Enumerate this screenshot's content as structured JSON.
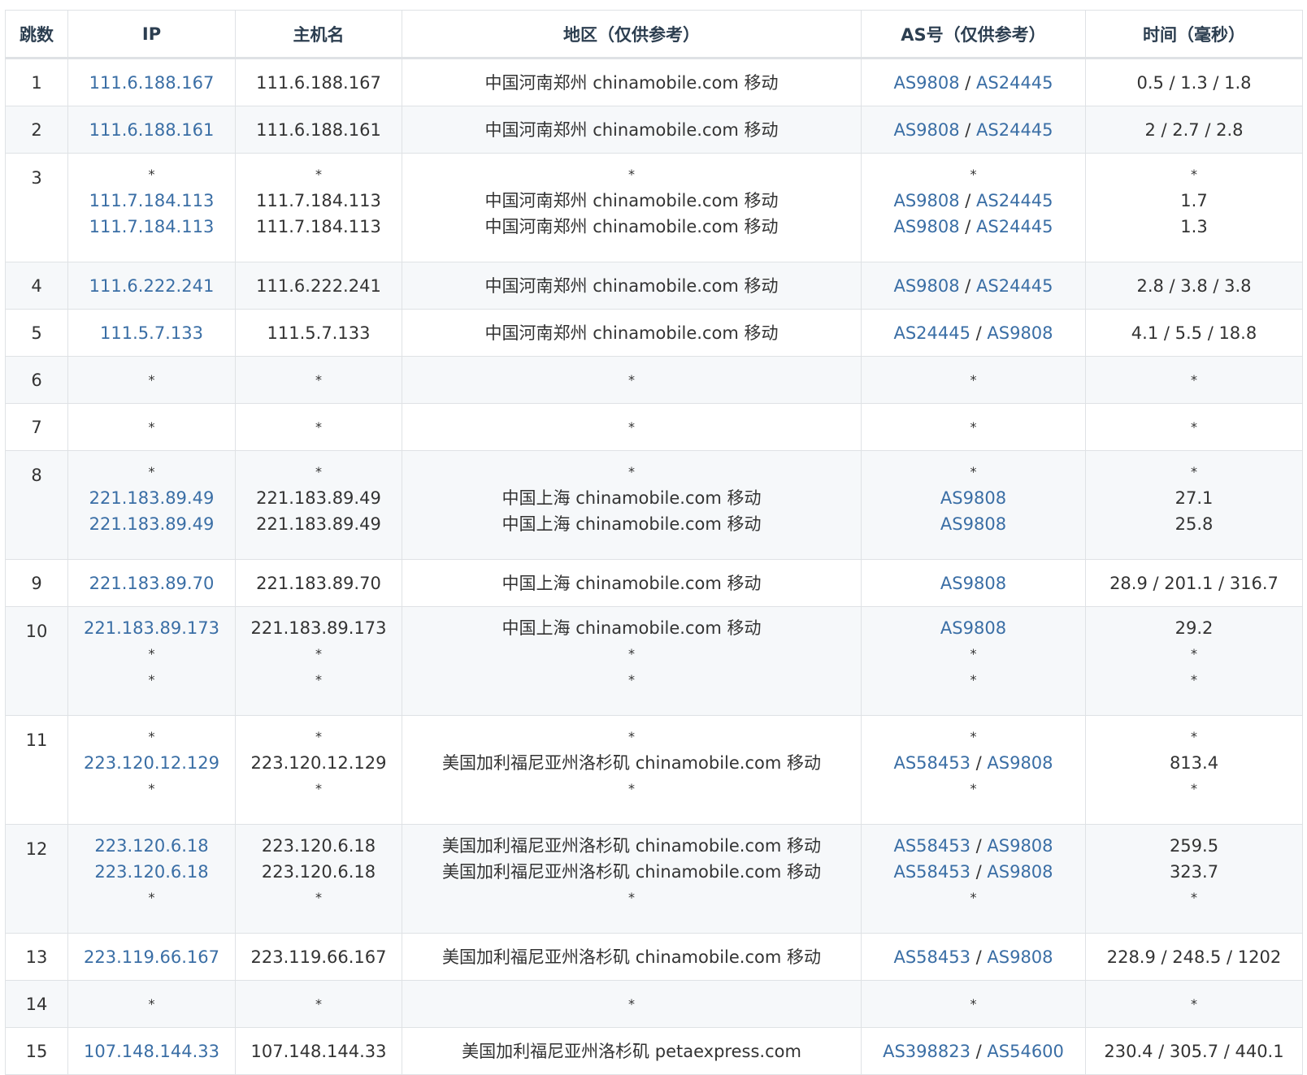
{
  "headers": [
    "跳数",
    "IP",
    "主机名",
    "地区（仅供参考）",
    "AS号（仅供参考）",
    "时间（毫秒）"
  ],
  "rows": [
    {
      "hop": "1",
      "ip": [
        "111.6.188.167"
      ],
      "host": [
        "111.6.188.167"
      ],
      "region": [
        "中国河南郑州 chinamobile.com 移动"
      ],
      "as": [
        [
          "AS9808",
          "AS24445"
        ]
      ],
      "time": [
        "0.5 / 1.3 / 1.8"
      ]
    },
    {
      "hop": "2",
      "ip": [
        "111.6.188.161"
      ],
      "host": [
        "111.6.188.161"
      ],
      "region": [
        "中国河南郑州 chinamobile.com 移动"
      ],
      "as": [
        [
          "AS9808",
          "AS24445"
        ]
      ],
      "time": [
        "2 / 2.7 / 2.8"
      ]
    },
    {
      "hop": "3",
      "ip": [
        "*",
        "111.7.184.113",
        "111.7.184.113"
      ],
      "host": [
        "*",
        "111.7.184.113",
        "111.7.184.113"
      ],
      "region": [
        "*",
        "中国河南郑州 chinamobile.com 移动",
        "中国河南郑州 chinamobile.com 移动"
      ],
      "as": [
        [
          "*"
        ],
        [
          "AS9808",
          "AS24445"
        ],
        [
          "AS9808",
          "AS24445"
        ]
      ],
      "time": [
        "*",
        "1.7",
        "1.3"
      ]
    },
    {
      "hop": "4",
      "ip": [
        "111.6.222.241"
      ],
      "host": [
        "111.6.222.241"
      ],
      "region": [
        "中国河南郑州 chinamobile.com 移动"
      ],
      "as": [
        [
          "AS9808",
          "AS24445"
        ]
      ],
      "time": [
        "2.8 / 3.8 / 3.8"
      ]
    },
    {
      "hop": "5",
      "ip": [
        "111.5.7.133"
      ],
      "host": [
        "111.5.7.133"
      ],
      "region": [
        "中国河南郑州 chinamobile.com 移动"
      ],
      "as": [
        [
          "AS24445",
          "AS9808"
        ]
      ],
      "time": [
        "4.1 / 5.5 / 18.8"
      ]
    },
    {
      "hop": "6",
      "ip": [
        "*"
      ],
      "host": [
        "*"
      ],
      "region": [
        "*"
      ],
      "as": [
        [
          "*"
        ]
      ],
      "time": [
        "*"
      ]
    },
    {
      "hop": "7",
      "ip": [
        "*"
      ],
      "host": [
        "*"
      ],
      "region": [
        "*"
      ],
      "as": [
        [
          "*"
        ]
      ],
      "time": [
        "*"
      ]
    },
    {
      "hop": "8",
      "ip": [
        "*",
        "221.183.89.49",
        "221.183.89.49"
      ],
      "host": [
        "*",
        "221.183.89.49",
        "221.183.89.49"
      ],
      "region": [
        "*",
        "中国上海 chinamobile.com 移动",
        "中国上海 chinamobile.com 移动"
      ],
      "as": [
        [
          "*"
        ],
        [
          "AS9808"
        ],
        [
          "AS9808"
        ]
      ],
      "time": [
        "*",
        "27.1",
        "25.8"
      ]
    },
    {
      "hop": "9",
      "ip": [
        "221.183.89.70"
      ],
      "host": [
        "221.183.89.70"
      ],
      "region": [
        "中国上海 chinamobile.com 移动"
      ],
      "as": [
        [
          "AS9808"
        ]
      ],
      "time": [
        "28.9 / 201.1 / 316.7"
      ]
    },
    {
      "hop": "10",
      "ip": [
        "221.183.89.173",
        "*",
        "*"
      ],
      "host": [
        "221.183.89.173",
        "*",
        "*"
      ],
      "region": [
        "中国上海 chinamobile.com 移动",
        "*",
        "*"
      ],
      "as": [
        [
          "AS9808"
        ],
        [
          "*"
        ],
        [
          "*"
        ]
      ],
      "time": [
        "29.2",
        "*",
        "*"
      ]
    },
    {
      "hop": "11",
      "ip": [
        "*",
        "223.120.12.129",
        "*"
      ],
      "host": [
        "*",
        "223.120.12.129",
        "*"
      ],
      "region": [
        "*",
        "美国加利福尼亚州洛杉矶 chinamobile.com 移动",
        "*"
      ],
      "as": [
        [
          "*"
        ],
        [
          "AS58453",
          "AS9808"
        ],
        [
          "*"
        ]
      ],
      "time": [
        "*",
        "813.4",
        "*"
      ]
    },
    {
      "hop": "12",
      "ip": [
        "223.120.6.18",
        "223.120.6.18",
        "*"
      ],
      "host": [
        "223.120.6.18",
        "223.120.6.18",
        "*"
      ],
      "region": [
        "美国加利福尼亚州洛杉矶 chinamobile.com 移动",
        "美国加利福尼亚州洛杉矶 chinamobile.com 移动",
        "*"
      ],
      "as": [
        [
          "AS58453",
          "AS9808"
        ],
        [
          "AS58453",
          "AS9808"
        ],
        [
          "*"
        ]
      ],
      "time": [
        "259.5",
        "323.7",
        "*"
      ]
    },
    {
      "hop": "13",
      "ip": [
        "223.119.66.167"
      ],
      "host": [
        "223.119.66.167"
      ],
      "region": [
        "美国加利福尼亚州洛杉矶 chinamobile.com 移动"
      ],
      "as": [
        [
          "AS58453",
          "AS9808"
        ]
      ],
      "time": [
        "228.9 / 248.5 / 1202"
      ]
    },
    {
      "hop": "14",
      "ip": [
        "*"
      ],
      "host": [
        "*"
      ],
      "region": [
        "*"
      ],
      "as": [
        [
          "*"
        ]
      ],
      "time": [
        "*"
      ]
    },
    {
      "hop": "15",
      "ip": [
        "107.148.144.33"
      ],
      "host": [
        "107.148.144.33"
      ],
      "region": [
        "美国加利福尼亚州洛杉矶 petaexpress.com"
      ],
      "as": [
        [
          "AS398823",
          "AS54600"
        ]
      ],
      "time": [
        "230.4 / 305.7 / 440.1"
      ]
    }
  ],
  "colors": {
    "link": "#3a6ea5",
    "border": "#dfe2e5",
    "stripe": "#f6f8fa",
    "header_text": "#2c3e50"
  }
}
